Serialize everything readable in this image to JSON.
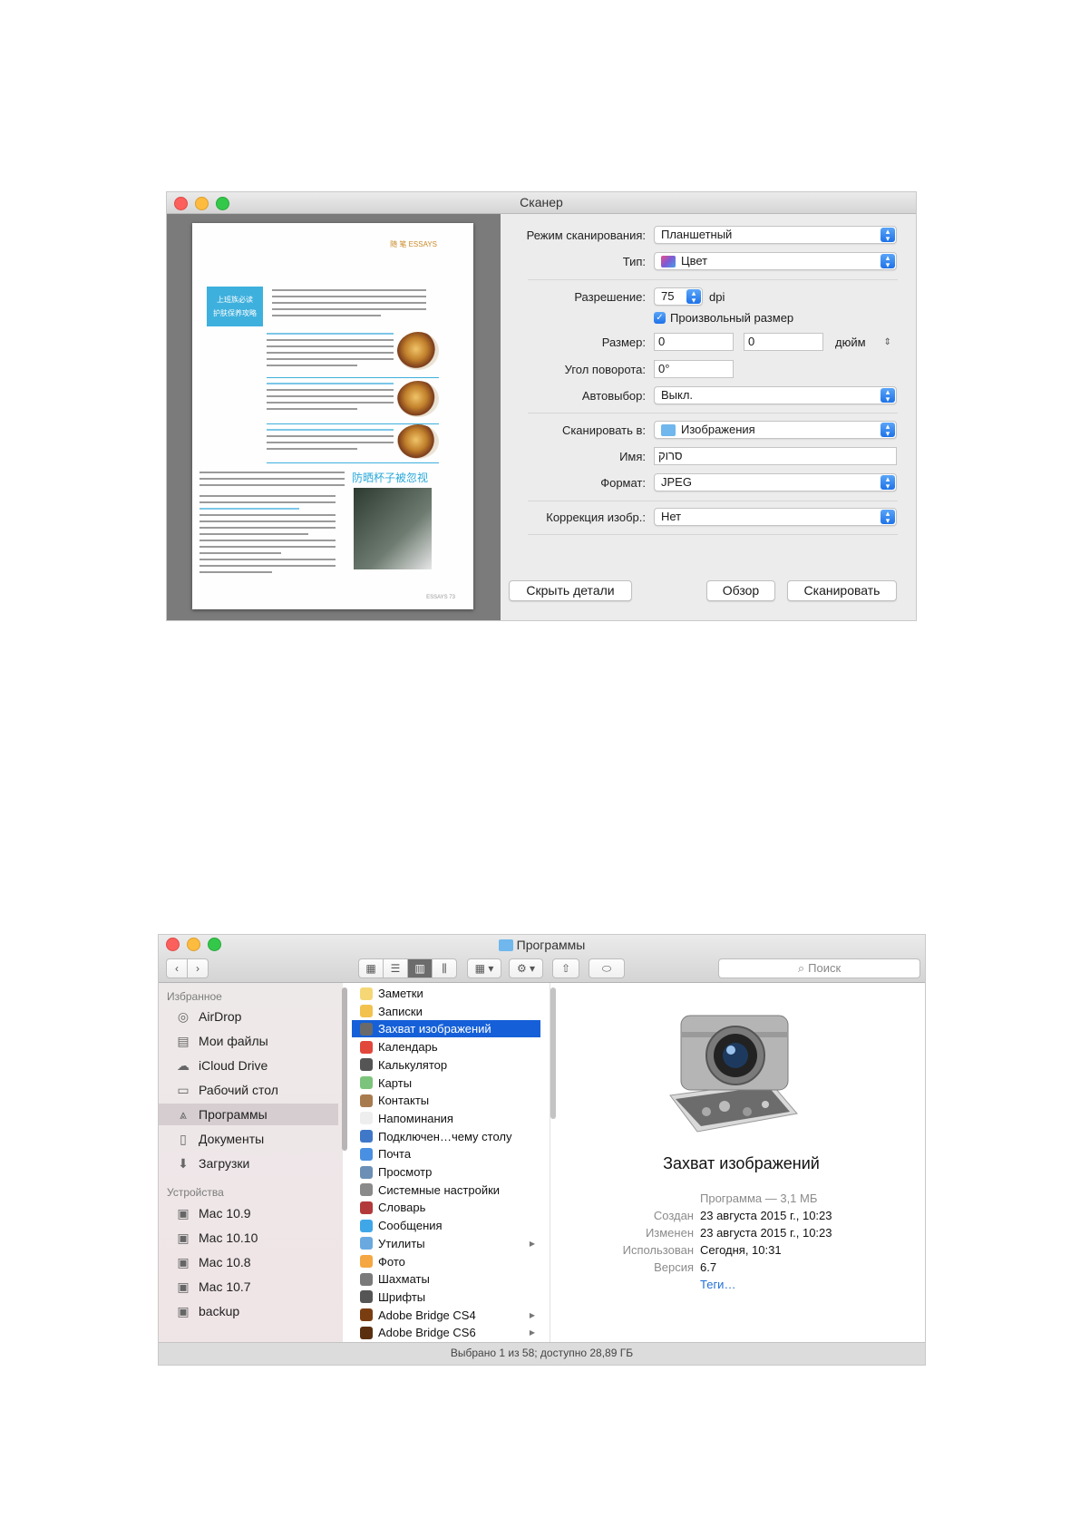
{
  "scanner": {
    "title": "Сканер",
    "preview": {
      "header_text": "随 笔 ESSAYS",
      "blue_box_line1": "上班族必读",
      "blue_box_line2": "护肤保养攻略",
      "side_heading": "防晒杯子被忽视",
      "footer": "ESSAYS 73"
    },
    "fields": {
      "scan_mode_label": "Режим сканирования:",
      "scan_mode_value": "Планшетный",
      "type_label": "Тип:",
      "type_value": "Цвет",
      "resolution_label": "Разрешение:",
      "resolution_value": "75",
      "resolution_unit": "dpi",
      "custom_size_label": "Произвольный размер",
      "custom_size_checked": true,
      "size_label": "Размер:",
      "size_w": "0",
      "size_h": "0",
      "size_unit": "дюйм",
      "rotation_label": "Угол поворота:",
      "rotation_value": "0°",
      "autoselect_label": "Автовыбор:",
      "autoselect_value": "Выкл.",
      "scan_to_label": "Сканировать в:",
      "scan_to_value": "Изображения",
      "name_label": "Имя:",
      "name_value": "סרוק",
      "format_label": "Формат:",
      "format_value": "JPEG",
      "correction_label": "Коррекция изобр.:",
      "correction_value": "Нет"
    },
    "buttons": {
      "hide_details": "Скрыть детали",
      "browse": "Обзор",
      "scan": "Сканировать"
    }
  },
  "finder": {
    "title": "Программы",
    "search_placeholder": "Поиск",
    "sidebar": {
      "favorites_heading": "Избранное",
      "favorites": [
        {
          "label": "AirDrop",
          "icon": "airdrop-icon"
        },
        {
          "label": "Мои файлы",
          "icon": "all-files-icon"
        },
        {
          "label": "iCloud Drive",
          "icon": "cloud-icon"
        },
        {
          "label": "Рабочий стол",
          "icon": "desktop-icon"
        },
        {
          "label": "Программы",
          "icon": "applications-icon",
          "selected": true
        },
        {
          "label": "Документы",
          "icon": "documents-icon"
        },
        {
          "label": "Загрузки",
          "icon": "downloads-icon"
        }
      ],
      "devices_heading": "Устройства",
      "devices": [
        {
          "label": "Mac 10.9",
          "icon": "disk-icon"
        },
        {
          "label": "Mac 10.10",
          "icon": "disk-icon"
        },
        {
          "label": "Mac 10.8",
          "icon": "disk-icon"
        },
        {
          "label": "Mac 10.7",
          "icon": "disk-icon"
        },
        {
          "label": "backup",
          "icon": "disk-icon"
        }
      ]
    },
    "apps": [
      {
        "label": "Заметки",
        "color": "#f5d776"
      },
      {
        "label": "Записки",
        "color": "#f2c14e"
      },
      {
        "label": "Захват изображений",
        "color": "#6a6a6a",
        "selected": true
      },
      {
        "label": "Календарь",
        "color": "#e2473b"
      },
      {
        "label": "Калькулятор",
        "color": "#555555"
      },
      {
        "label": "Карты",
        "color": "#7cc47b"
      },
      {
        "label": "Контакты",
        "color": "#a87b4f"
      },
      {
        "label": "Напоминания",
        "color": "#eeeeee"
      },
      {
        "label": "Подключен…чему столу",
        "color": "#3f78c9"
      },
      {
        "label": "Почта",
        "color": "#4a90e2"
      },
      {
        "label": "Просмотр",
        "color": "#6b8fb5"
      },
      {
        "label": "Системные настройки",
        "color": "#8a8a8a"
      },
      {
        "label": "Словарь",
        "color": "#b33a3a"
      },
      {
        "label": "Сообщения",
        "color": "#3fa7e8"
      },
      {
        "label": "Утилиты",
        "color": "#6aa9e0",
        "has_arrow": true
      },
      {
        "label": "Фото",
        "color": "#f4a742"
      },
      {
        "label": "Шахматы",
        "color": "#7a7a7a"
      },
      {
        "label": "Шрифты",
        "color": "#555555"
      },
      {
        "label": "Adobe Bridge CS4",
        "color": "#7a3d12",
        "has_arrow": true
      },
      {
        "label": "Adobe Bridge CS6",
        "color": "#5a2f0f",
        "has_arrow": true
      }
    ],
    "preview": {
      "app_name": "Захват изображений",
      "kind": "Программа — 3,1 МБ",
      "created_label": "Создан",
      "created_value": "23 августа 2015 г., 10:23",
      "modified_label": "Изменен",
      "modified_value": "23 августа 2015 г., 10:23",
      "used_label": "Использован",
      "used_value": "Сегодня, 10:31",
      "version_label": "Версия",
      "version_value": "6.7",
      "tags_link": "Теги…"
    },
    "status": "Выбрано 1 из 58; доступно 28,89 ГБ"
  }
}
